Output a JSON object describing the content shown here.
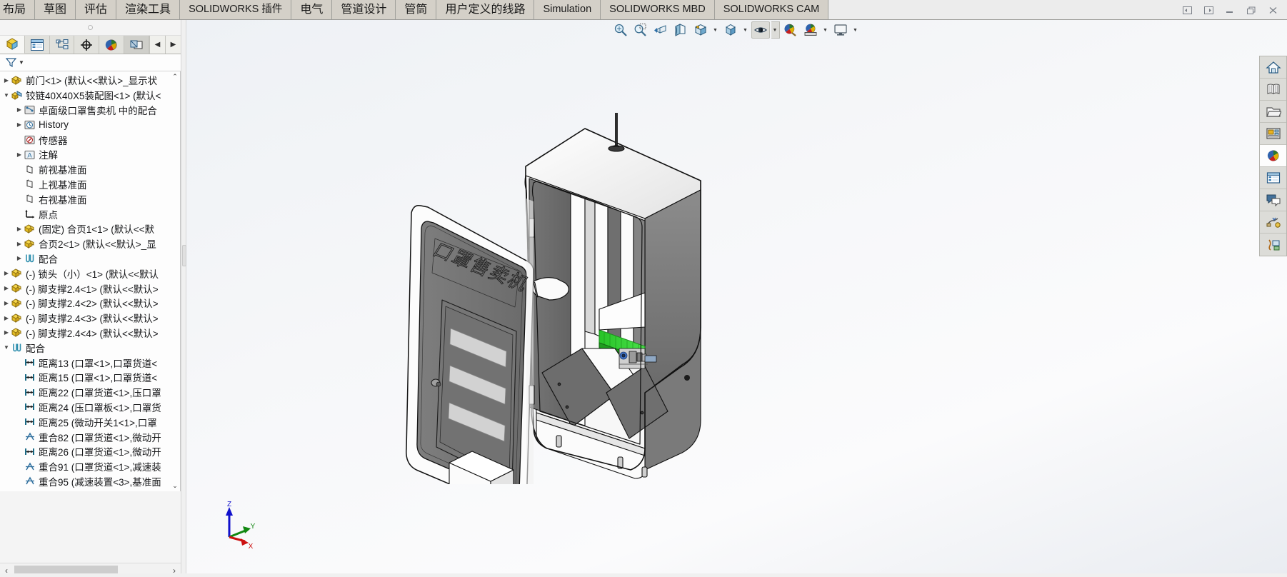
{
  "app": {
    "title": "SOLIDWORKS",
    "ribbon_tabs": [
      {
        "label": "布局",
        "cjk": true
      },
      {
        "label": "草图",
        "cjk": true
      },
      {
        "label": "评估",
        "cjk": true
      },
      {
        "label": "渲染工具",
        "cjk": true
      },
      {
        "label": "SOLIDWORKS 插件",
        "cjk": true
      },
      {
        "label": "电气",
        "cjk": true
      },
      {
        "label": "管道设计",
        "cjk": true
      },
      {
        "label": "管筒",
        "cjk": true
      },
      {
        "label": "用户定义的线路",
        "cjk": true
      },
      {
        "label": "Simulation",
        "cjk": false
      },
      {
        "label": "SOLIDWORKS MBD",
        "cjk": false
      },
      {
        "label": "SOLIDWORKS CAM",
        "cjk": false
      }
    ],
    "window_buttons": [
      {
        "name": "restore-left-icon",
        "glyph": "◧"
      },
      {
        "name": "restore-right-icon",
        "glyph": "◨"
      },
      {
        "name": "minimize-icon",
        "glyph": "—"
      },
      {
        "name": "maximize-icon",
        "glyph": "❐"
      },
      {
        "name": "close-icon",
        "glyph": "✕"
      }
    ]
  },
  "left_panel": {
    "tabs": [
      {
        "name": "feature-manager-tab",
        "title": "FeatureManager 设计树",
        "selected": true
      },
      {
        "name": "property-manager-tab",
        "title": "PropertyManager",
        "selected": false
      },
      {
        "name": "configuration-manager-tab",
        "title": "ConfigurationManager",
        "selected": false
      },
      {
        "name": "dimxpert-manager-tab",
        "title": "DimXpertManager",
        "selected": false
      },
      {
        "name": "display-manager-tab",
        "title": "DisplayManager",
        "selected": false
      },
      {
        "name": "appearances-tab",
        "title": "外观",
        "selected": false
      }
    ],
    "collapse_button": "◀",
    "filter": {
      "name": "filter-icon",
      "placeholder": ""
    },
    "tree_items": [
      {
        "label": "前门<1> (默认<<默认>_显示状",
        "icon": "part",
        "indent": 0,
        "twisty": "right"
      },
      {
        "label": "铰链40X40X5装配图<1> (默认<",
        "icon": "assembly",
        "indent": 0,
        "twisty": "down"
      },
      {
        "label": "卓面级口罩售卖机 中的配合",
        "icon": "mates-folder",
        "indent": 1,
        "twisty": "right"
      },
      {
        "label": "History",
        "icon": "history",
        "indent": 1,
        "twisty": "right"
      },
      {
        "label": "传感器",
        "icon": "sensors",
        "indent": 1,
        "twisty": "none"
      },
      {
        "label": "注解",
        "icon": "annotations",
        "indent": 1,
        "twisty": "right"
      },
      {
        "label": "前视基准面",
        "icon": "plane",
        "indent": 1,
        "twisty": "none"
      },
      {
        "label": "上视基准面",
        "icon": "plane",
        "indent": 1,
        "twisty": "none"
      },
      {
        "label": "右视基准面",
        "icon": "plane",
        "indent": 1,
        "twisty": "none"
      },
      {
        "label": "原点",
        "icon": "origin",
        "indent": 1,
        "twisty": "none"
      },
      {
        "label": "(固定) 合页1<1> (默认<<默",
        "icon": "part",
        "indent": 1,
        "twisty": "right"
      },
      {
        "label": "合页2<1> (默认<<默认>_显",
        "icon": "part",
        "indent": 1,
        "twisty": "right"
      },
      {
        "label": "配合",
        "icon": "mates",
        "indent": 1,
        "twisty": "right"
      },
      {
        "label": "(-) 锁头（小）<1> (默认<<默认",
        "icon": "part",
        "indent": 0,
        "twisty": "right"
      },
      {
        "label": "(-) 脚支撑2.4<1> (默认<<默认>",
        "icon": "part",
        "indent": 0,
        "twisty": "right"
      },
      {
        "label": "(-) 脚支撑2.4<2> (默认<<默认>",
        "icon": "part",
        "indent": 0,
        "twisty": "right"
      },
      {
        "label": "(-) 脚支撑2.4<3> (默认<<默认>",
        "icon": "part",
        "indent": 0,
        "twisty": "right"
      },
      {
        "label": "(-) 脚支撑2.4<4> (默认<<默认>",
        "icon": "part",
        "indent": 0,
        "twisty": "right"
      },
      {
        "label": "配合",
        "icon": "mates",
        "indent": 0,
        "twisty": "down"
      },
      {
        "label": "距离13 (口罩<1>,口罩货道<",
        "icon": "distance-mate",
        "indent": 1,
        "twisty": "none"
      },
      {
        "label": "距离15 (口罩<1>,口罩货道<",
        "icon": "distance-mate",
        "indent": 1,
        "twisty": "none"
      },
      {
        "label": "距离22 (口罩货道<1>,压口罩",
        "icon": "distance-mate",
        "indent": 1,
        "twisty": "none"
      },
      {
        "label": "距离24 (压口罩板<1>,口罩货",
        "icon": "distance-mate",
        "indent": 1,
        "twisty": "none"
      },
      {
        "label": "距离25 (微动开关1<1>,口罩",
        "icon": "distance-mate",
        "indent": 1,
        "twisty": "none"
      },
      {
        "label": "重合82 (口罩货道<1>,微动开",
        "icon": "coincident-mate",
        "indent": 1,
        "twisty": "none"
      },
      {
        "label": "距离26 (口罩货道<1>,微动开",
        "icon": "distance-mate",
        "indent": 1,
        "twisty": "none"
      },
      {
        "label": "重合91 (口罩货道<1>,减速装",
        "icon": "coincident-mate",
        "indent": 1,
        "twisty": "none"
      },
      {
        "label": "重合95 (减速装置<3>,基准面",
        "icon": "coincident-mate",
        "indent": 1,
        "twisty": "none"
      }
    ],
    "scroll": {
      "up": "⌃",
      "down": "⌄",
      "left": "‹",
      "right": "›"
    }
  },
  "viewport": {
    "toolbar": [
      {
        "name": "zoom-to-fit-button",
        "icon": "zoom-fit",
        "caret": false,
        "pressed": false
      },
      {
        "name": "zoom-to-area-button",
        "icon": "zoom-area",
        "caret": false,
        "pressed": false
      },
      {
        "name": "previous-view-button",
        "icon": "previous-view",
        "caret": false,
        "pressed": false
      },
      {
        "name": "section-view-button",
        "icon": "section-view",
        "caret": false,
        "pressed": false
      },
      {
        "name": "view-orientation-button",
        "icon": "view-orientation",
        "caret": true,
        "pressed": false
      },
      {
        "name": "display-style-button",
        "icon": "display-style",
        "caret": true,
        "pressed": false
      },
      {
        "name": "hide-show-items-button",
        "icon": "hide-show",
        "caret": true,
        "pressed": true
      },
      {
        "name": "edit-appearance-button",
        "icon": "edit-appearance",
        "caret": false,
        "pressed": false
      },
      {
        "name": "apply-scene-button",
        "icon": "apply-scene",
        "caret": true,
        "pressed": false
      },
      {
        "name": "view-settings-button",
        "icon": "view-settings",
        "caret": true,
        "pressed": false
      }
    ],
    "right_toolbar": [
      {
        "name": "view-home-icon",
        "title": "主页"
      },
      {
        "name": "view-books-icon",
        "title": "SOLIDWORKS 资源"
      },
      {
        "name": "design-library-icon",
        "title": "设计库"
      },
      {
        "name": "file-explorer-icon",
        "title": "文件探索器"
      },
      {
        "name": "view-palette-icon",
        "title": "视图调色板"
      },
      {
        "name": "appearances-scenes-icon",
        "title": "外观、布景和贴图"
      },
      {
        "name": "custom-properties-icon",
        "title": "自定义属性"
      },
      {
        "name": "sheet-format-icon",
        "title": "图纸格式"
      },
      {
        "name": "solidworks-forum-icon",
        "title": "SOLIDWORKS 论坛"
      }
    ],
    "triad": {
      "x_label": "X",
      "y_label": "Y",
      "z_label": "Z",
      "x_color": "#cc1111",
      "y_color": "#118811",
      "z_color": "#1111cc"
    },
    "model": {
      "name": "卓面级口罩售卖机",
      "door_text": "口罩售卖机",
      "colors": {
        "body_light": "#fdfdfd",
        "body_gray": "#6f6f6f",
        "body_mid": "#8a8a8a",
        "outline": "#1a1a1a",
        "highlight_green": "#2ecc2e",
        "shadow": "#cfcfcf"
      }
    }
  }
}
